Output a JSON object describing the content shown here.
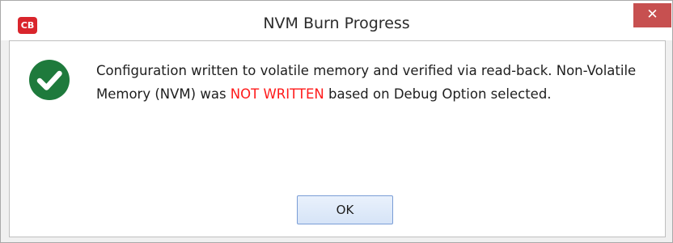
{
  "window": {
    "title": "NVM Burn Progress",
    "app_icon_text": "CB",
    "close_glyph": "✕"
  },
  "message": {
    "text_before": "Configuration written to volatile memory and verified via read-back. Non-Volatile Memory (NVM) was ",
    "highlight": "NOT WRITTEN",
    "text_after": " based on Debug Option selected."
  },
  "buttons": {
    "ok_label": "OK"
  },
  "icons": {
    "status": "success-check-icon"
  },
  "colors": {
    "success": "#1e7a3c",
    "warning_text": "#ff1a1a",
    "app_icon": "#d9252c",
    "close_button": "#c75050"
  }
}
